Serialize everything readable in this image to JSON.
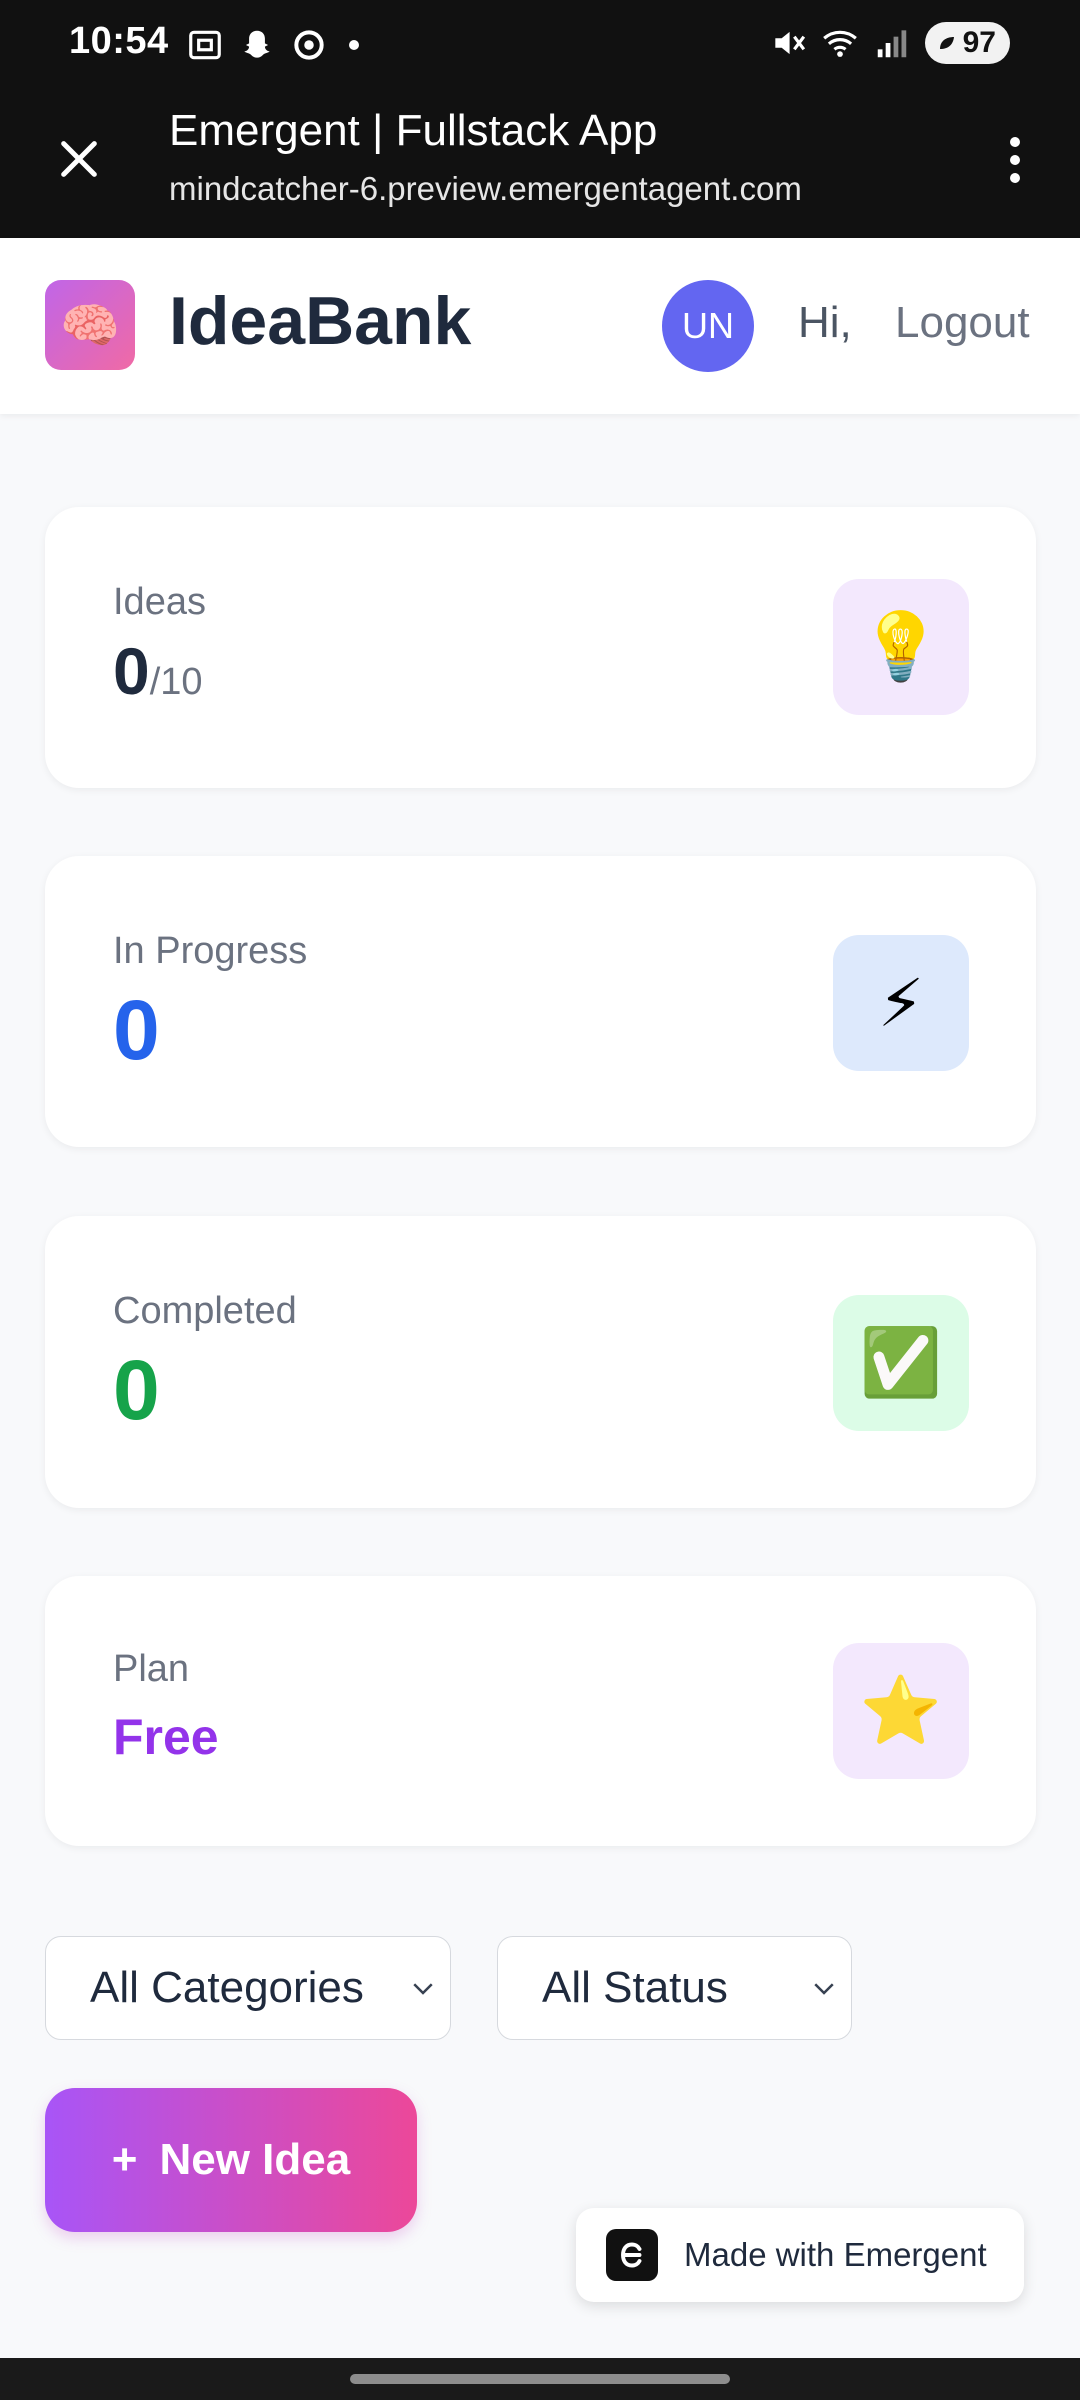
{
  "status_bar": {
    "time": "10:54",
    "battery": "97",
    "left_icons": [
      "screenshot-icon",
      "snapchat-icon",
      "target-icon",
      "dot-icon"
    ],
    "right_icons": [
      "mute-icon",
      "wifi-icon",
      "signal-icon",
      "battery-icon"
    ]
  },
  "browser": {
    "title": "Emergent | Fullstack App",
    "url": "mindcatcher-6.preview.emergentagent.com"
  },
  "header": {
    "logo_emoji": "🧠",
    "brand": "IdeaBank",
    "avatar_initials": "UN",
    "greeting": "Hi,",
    "logout_label": "Logout"
  },
  "stats": {
    "ideas": {
      "label": "Ideas",
      "value": "0",
      "limit": "/10",
      "icon": "💡",
      "value_color": "#1f2a3d",
      "icon_bg": "#f3e8fd"
    },
    "in_progress": {
      "label": "In Progress",
      "value": "0",
      "icon": "⚡",
      "value_color": "#2563eb",
      "icon_bg": "#dde9fc"
    },
    "completed": {
      "label": "Completed",
      "value": "0",
      "icon": "✅",
      "value_color": "#16a34a",
      "icon_bg": "#dcfce7"
    },
    "plan": {
      "label": "Plan",
      "value": "Free",
      "icon": "⭐",
      "value_color": "#9333ea",
      "icon_bg": "#f3e8fd"
    }
  },
  "filters": {
    "category_selected": "All Categories",
    "status_selected": "All Status"
  },
  "actions": {
    "new_idea_plus": "+",
    "new_idea_label": "New Idea"
  },
  "badge": {
    "label": "Made with Emergent"
  }
}
